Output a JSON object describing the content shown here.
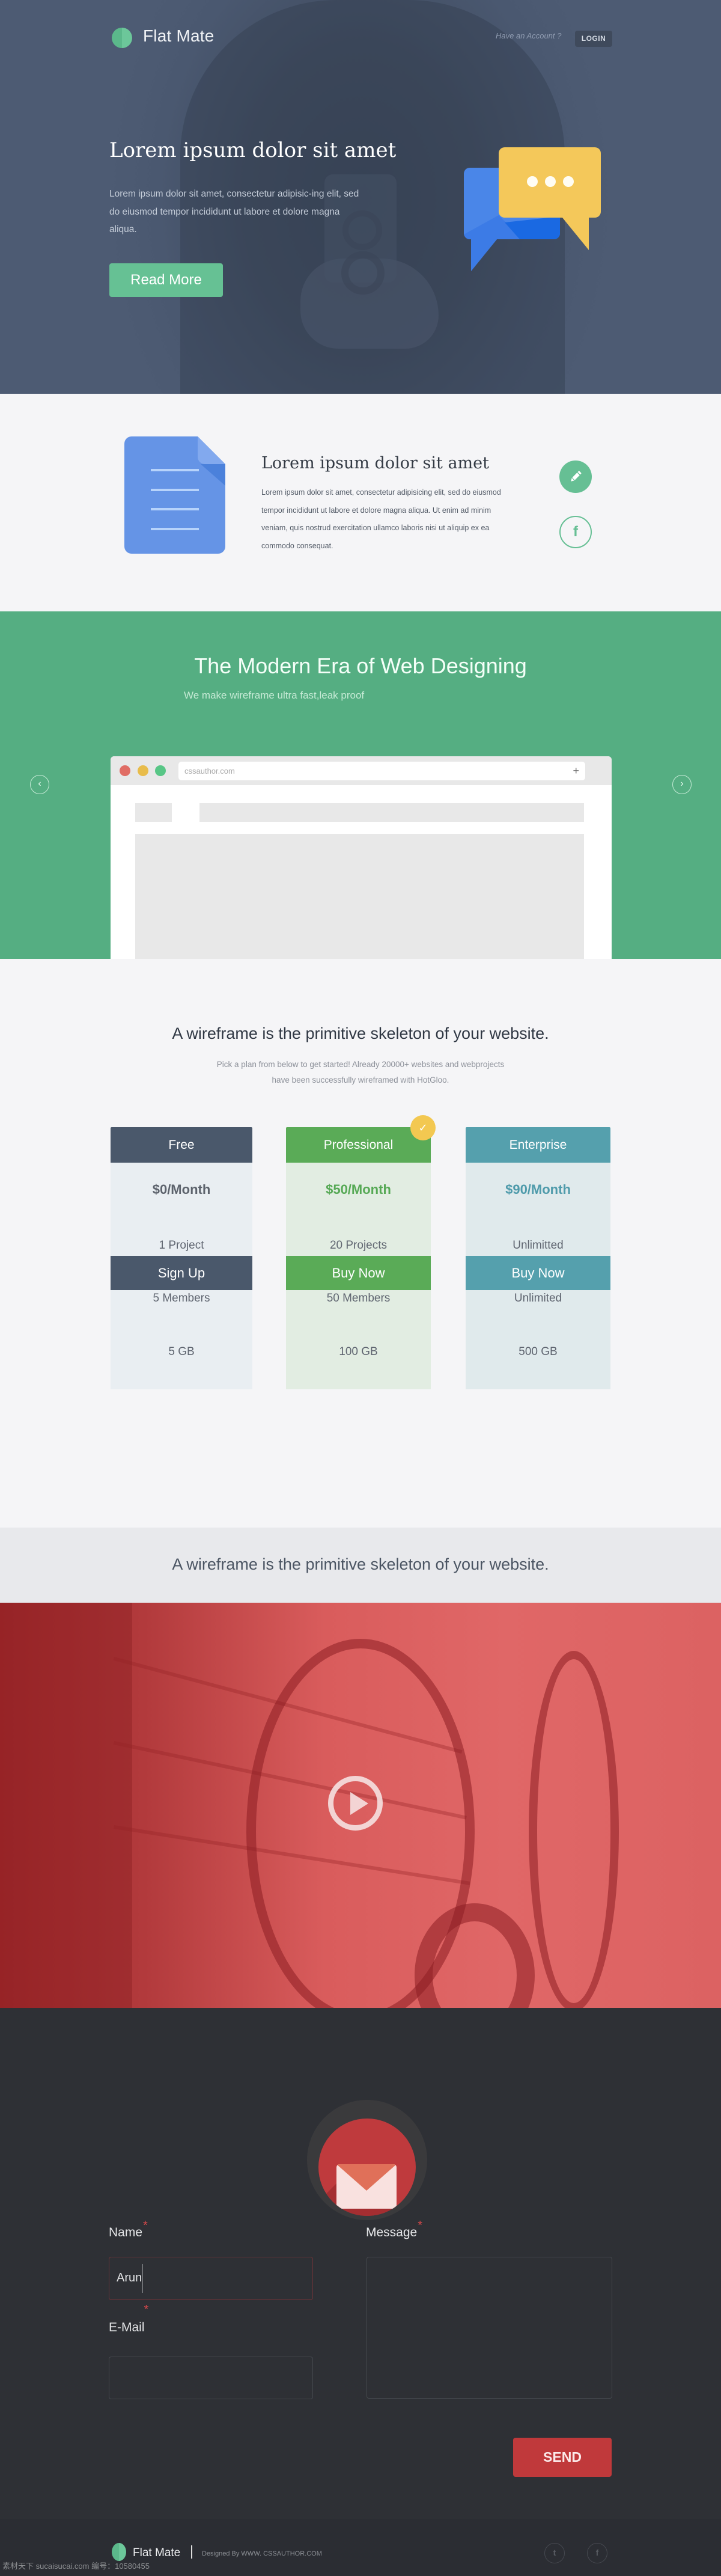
{
  "header": {
    "brand": "Flat Mate",
    "account_prompt": "Have an Account ?",
    "login_label": "LOGIN"
  },
  "hero": {
    "title": "Lorem ipsum dolor sit amet",
    "text": "Lorem ipsum dolor sit amet, consectetur adipisic-ing elit, sed do eiusmod tempor incididunt ut labore et dolore magna aliqua.",
    "cta_label": "Read More",
    "illustration": "chat-bubbles-icon"
  },
  "feature": {
    "icon": "document-icon",
    "title": "Lorem ipsum dolor sit amet",
    "text": "Lorem ipsum dolor sit amet, consectetur adipisicing elit, sed do eiusmod tempor incididunt ut labore et dolore magna aliqua. Ut enim ad minim veniam, quis nostrud exercitation ullamco laboris nisi ut aliquip ex ea commodo consequat.",
    "actions": [
      {
        "icon": "pencil-icon"
      },
      {
        "icon": "facebook-icon",
        "glyph": "f"
      }
    ]
  },
  "showcase": {
    "title": "The Modern Era of Web Designing",
    "subtitle": "We make wireframe ultra fast,leak proof",
    "prev_glyph": "‹",
    "next_glyph": "›",
    "browser": {
      "url": "cssauthor.com",
      "new_tab_glyph": "+"
    }
  },
  "pricing": {
    "title": "A wireframe is the primitive skeleton of your website.",
    "subtitle_line1": "Pick a plan from below to get started! Already 20000+ websites and webprojects",
    "subtitle_line2": "have been successfully wireframed with HotGloo.",
    "featured_badge": "✓",
    "plans": [
      {
        "name": "Free",
        "price": "$0/Month",
        "features": [
          "1 Project",
          "5 Members",
          "5 GB"
        ],
        "button": "Sign Up",
        "color": "#4a586b",
        "bg": "#e9eef2",
        "price_color": "#5d636d"
      },
      {
        "name": "Professional",
        "price": "$50/Month",
        "features": [
          "20 Projects",
          "50 Members",
          "100 GB"
        ],
        "button": "Buy Now",
        "color": "#5aab57",
        "bg": "#e2ede2",
        "price_color": "#56a955"
      },
      {
        "name": "Enterprise",
        "price": "$90/Month",
        "features": [
          "Unlimitted",
          "Unlimited",
          "500 GB"
        ],
        "button": "Buy Now",
        "color": "#55a0ad",
        "bg": "#e0eaec",
        "price_color": "#4f9bab"
      }
    ]
  },
  "band": {
    "text": "A wireframe is the primitive skeleton of your website."
  },
  "video": {
    "action": "play-icon"
  },
  "contact": {
    "icon": "mail-icon",
    "name_label": "Name",
    "name_value": "Arun",
    "email_label": "E-Mail",
    "email_value": "",
    "message_label": "Message",
    "message_value": "",
    "required_mark": "*",
    "send_label": "SEND"
  },
  "footer": {
    "brand": "Flat Mate",
    "credit": "Designed By WWW. CSSAUTHOR.COM",
    "social": [
      {
        "icon": "twitter-icon",
        "glyph": "t"
      },
      {
        "icon": "facebook-icon",
        "glyph": "f"
      }
    ],
    "watermark": "素材天下 sucaisucai.com  编号：10580455"
  },
  "colors": {
    "brand_green": "#66c194",
    "hero_bg": "#44506a",
    "showcase_green": "#55ae82",
    "video_red": "#d95c5c",
    "contact_bg": "#2e3035",
    "send_red": "#c0393b"
  }
}
